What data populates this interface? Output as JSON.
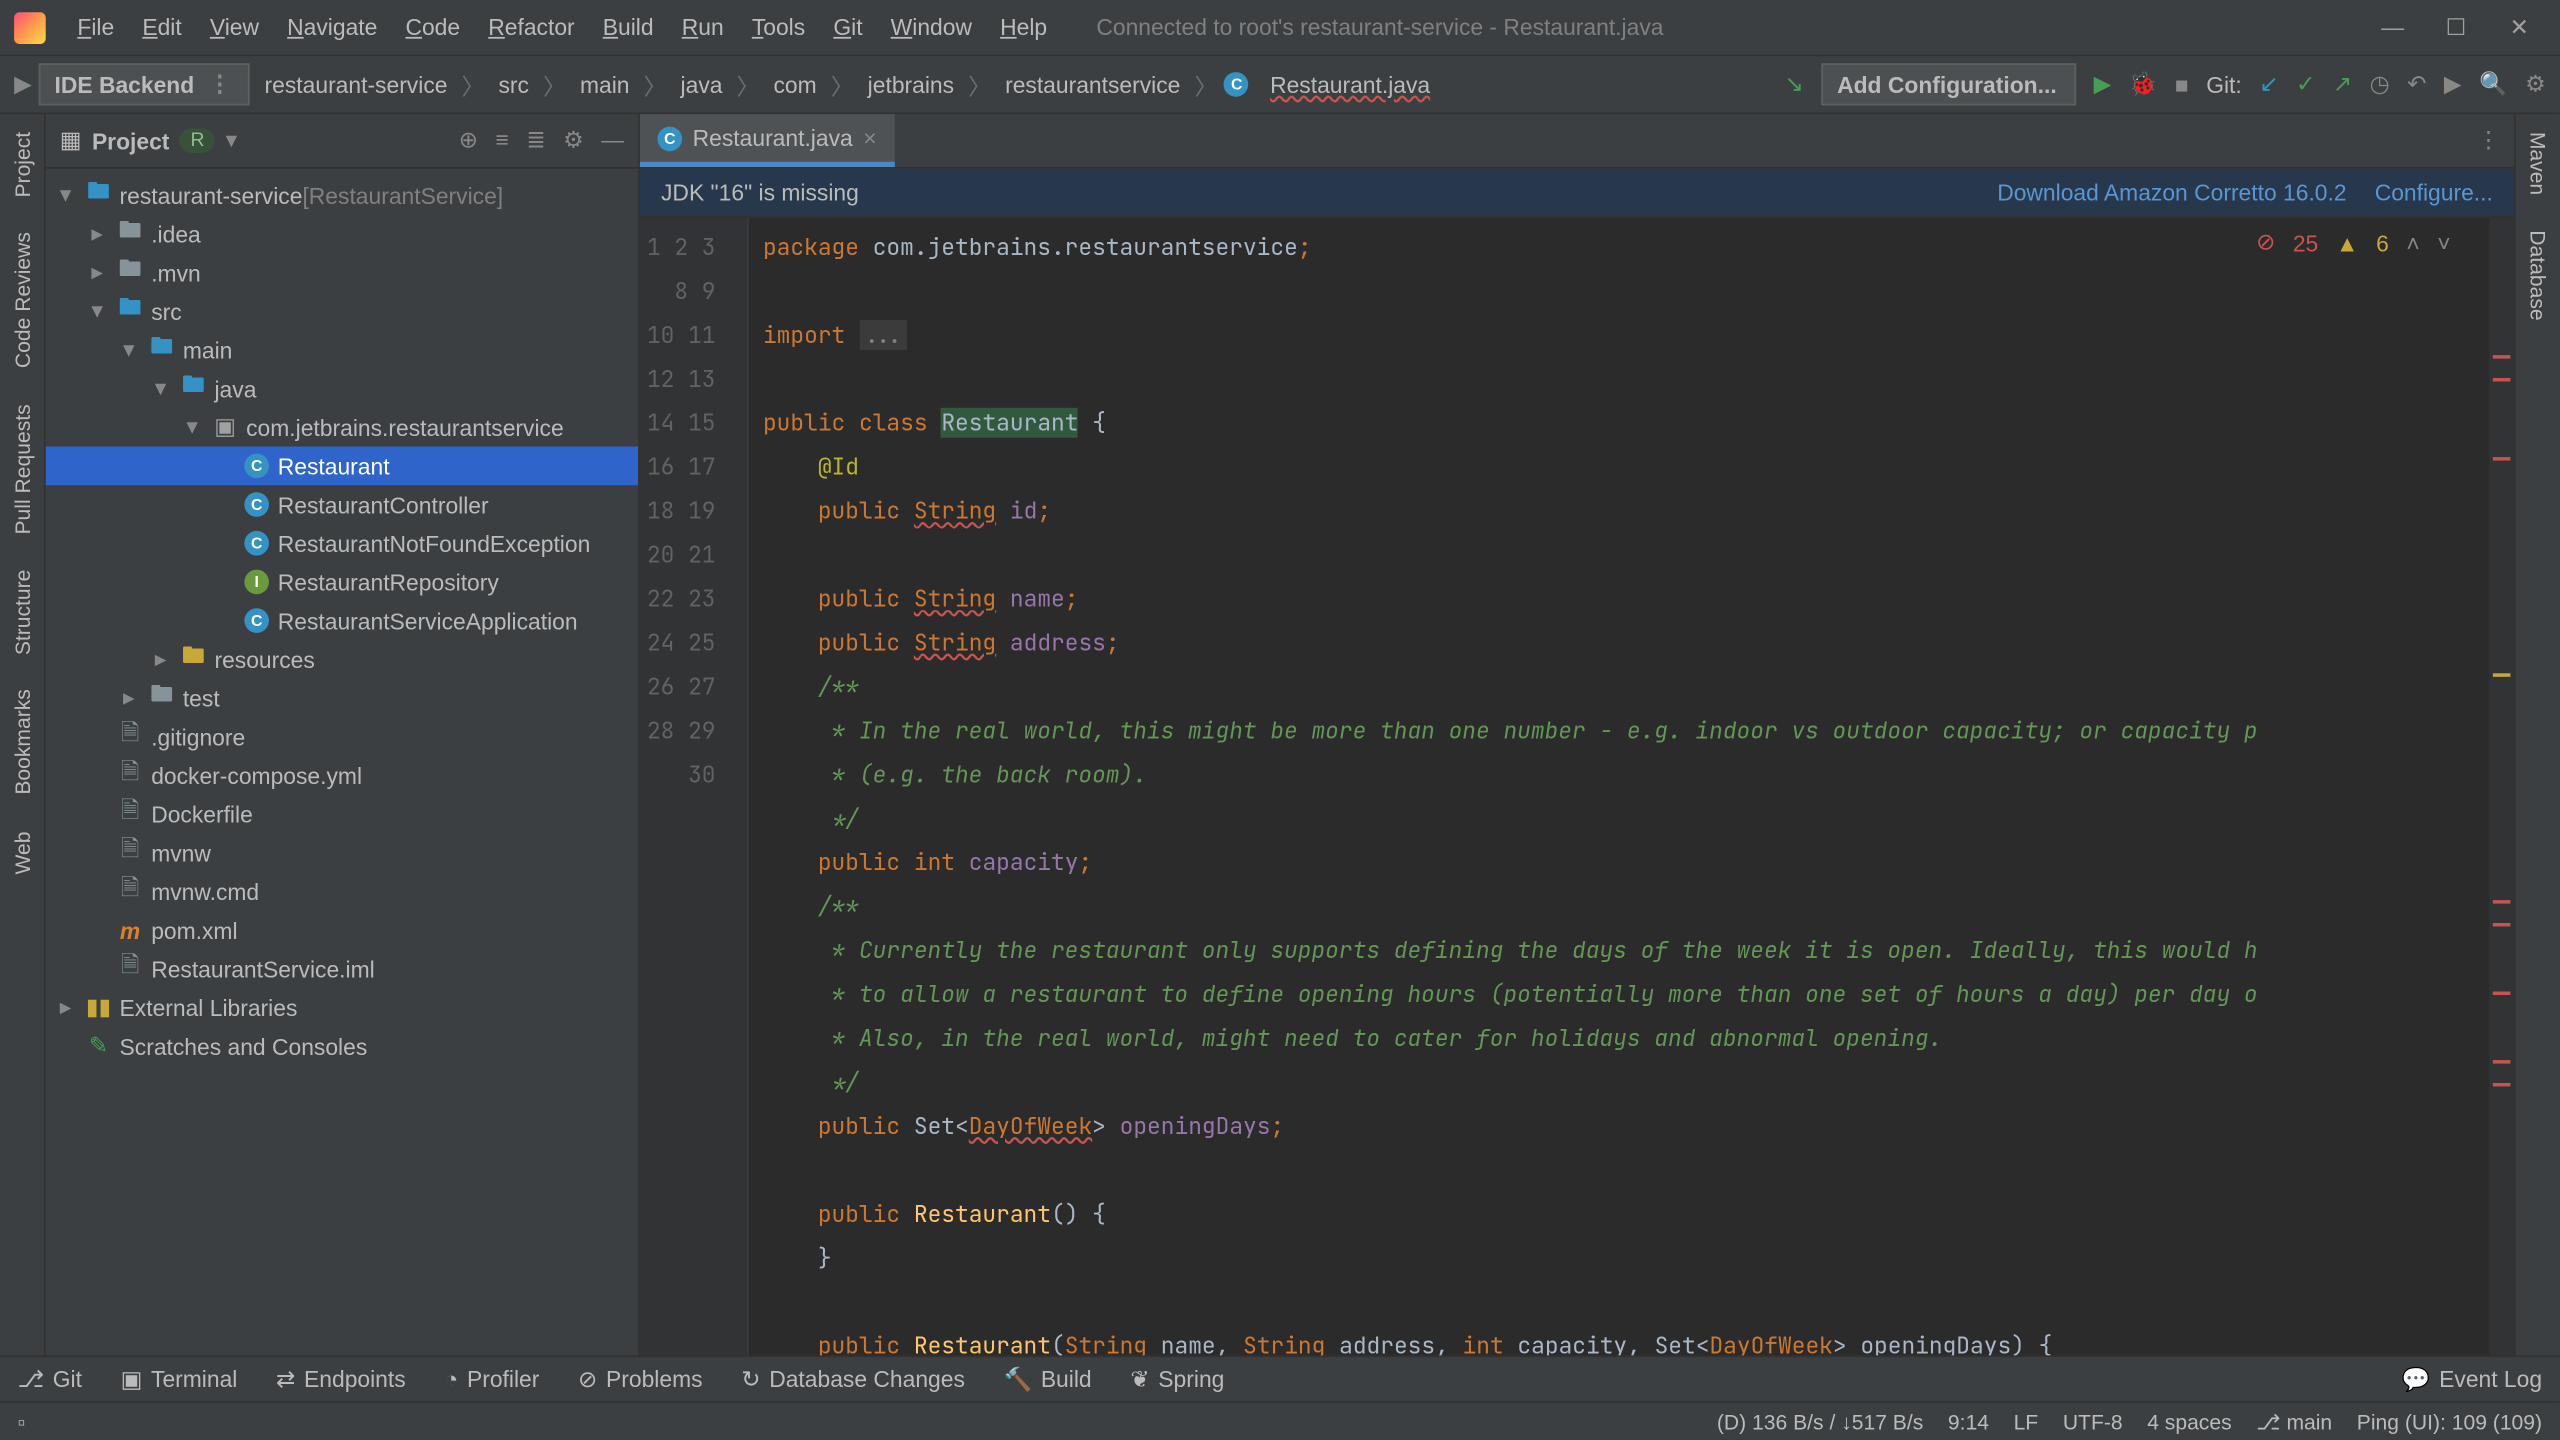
{
  "titlebar": {
    "menus": [
      "File",
      "Edit",
      "View",
      "Navigate",
      "Code",
      "Refactor",
      "Build",
      "Run",
      "Tools",
      "Git",
      "Window",
      "Help"
    ],
    "title": "Connected to root's restaurant-service - Restaurant.java"
  },
  "toolbar": {
    "run_config": "IDE Backend",
    "breadcrumbs": [
      "restaurant-service",
      "src",
      "main",
      "java",
      "com",
      "jetbrains",
      "restaurantservice",
      "Restaurant.java"
    ],
    "git_label": "Git:",
    "add_config": "Add Configuration..."
  },
  "left_gutter": {
    "tabs": [
      "Project",
      "Code Reviews",
      "Pull Requests",
      "Structure",
      "Bookmarks",
      "Web"
    ]
  },
  "right_gutter": {
    "tabs": [
      "Maven",
      "Database"
    ]
  },
  "project": {
    "header": "Project",
    "pill": "R",
    "tree": [
      {
        "depth": 0,
        "arrow": "▾",
        "icon": "folder-blue",
        "label": "restaurant-service",
        "suffix": " [RestaurantService]"
      },
      {
        "depth": 1,
        "arrow": "▸",
        "icon": "folder",
        "label": ".idea"
      },
      {
        "depth": 1,
        "arrow": "▸",
        "icon": "folder",
        "label": ".mvn"
      },
      {
        "depth": 1,
        "arrow": "▾",
        "icon": "folder-blue",
        "label": "src"
      },
      {
        "depth": 2,
        "arrow": "▾",
        "icon": "folder-blue",
        "label": "main"
      },
      {
        "depth": 3,
        "arrow": "▾",
        "icon": "folder-blue",
        "label": "java"
      },
      {
        "depth": 4,
        "arrow": "▾",
        "icon": "package",
        "label": "com.jetbrains.restaurantservice"
      },
      {
        "depth": 5,
        "arrow": "",
        "icon": "class",
        "label": "Restaurant",
        "selected": true
      },
      {
        "depth": 5,
        "arrow": "",
        "icon": "class",
        "label": "RestaurantController"
      },
      {
        "depth": 5,
        "arrow": "",
        "icon": "class",
        "label": "RestaurantNotFoundException"
      },
      {
        "depth": 5,
        "arrow": "",
        "icon": "interface",
        "label": "RestaurantRepository"
      },
      {
        "depth": 5,
        "arrow": "",
        "icon": "class",
        "label": "RestaurantServiceApplication"
      },
      {
        "depth": 3,
        "arrow": "▸",
        "icon": "resources",
        "label": "resources"
      },
      {
        "depth": 2,
        "arrow": "▸",
        "icon": "folder",
        "label": "test"
      },
      {
        "depth": 1,
        "arrow": "",
        "icon": "file",
        "label": ".gitignore"
      },
      {
        "depth": 1,
        "arrow": "",
        "icon": "file",
        "label": "docker-compose.yml"
      },
      {
        "depth": 1,
        "arrow": "",
        "icon": "file",
        "label": "Dockerfile"
      },
      {
        "depth": 1,
        "arrow": "",
        "icon": "file",
        "label": "mvnw"
      },
      {
        "depth": 1,
        "arrow": "",
        "icon": "file",
        "label": "mvnw.cmd"
      },
      {
        "depth": 1,
        "arrow": "",
        "icon": "m",
        "label": "pom.xml"
      },
      {
        "depth": 1,
        "arrow": "",
        "icon": "file",
        "label": "RestaurantService.iml"
      },
      {
        "depth": 0,
        "arrow": "▸",
        "icon": "lib",
        "label": "External Libraries"
      },
      {
        "depth": 0,
        "arrow": "",
        "icon": "scratch",
        "label": "Scratches and Consoles"
      }
    ]
  },
  "editor": {
    "tab_name": "Restaurant.java",
    "banner_msg": "JDK \"16\" is missing",
    "banner_link1": "Download Amazon Corretto 16.0.2",
    "banner_link2": "Configure...",
    "errors": "25",
    "warnings": "6",
    "code": {
      "l1_pkg": "package",
      "l1_rest": "com.jetbrains.restaurantservice",
      "l3_imp": "import",
      "l3_dots": "...",
      "l9_pub": "public",
      "l9_cls": "class",
      "l9_name": "Restaurant",
      "l9_brace": " {",
      "l10": "@Id",
      "l11_pub": "public",
      "l11_str": "String",
      "l11_id": "id",
      "l13_pub": "public",
      "l13_str": "String",
      "l13_name": "name",
      "l14_pub": "public",
      "l14_str": "String",
      "l14_addr": "address",
      "l15": "/**",
      "l16": " * In the real world, this might be more than one number - e.g. indoor vs outdoor capacity; or capacity p",
      "l17": " * (e.g. the back room).",
      "l18": " */",
      "l19_pub": "public",
      "l19_int": "int",
      "l19_cap": "capacity",
      "l20": "/**",
      "l21": " * Currently the restaurant only supports defining the days of the week it is open. Ideally, this would h",
      "l22": " * to allow a restaurant to define opening hours (potentially more than one set of hours a day) per day o",
      "l23": " * Also, in the real world, might need to cater for holidays and abnormal opening.",
      "l24": " */",
      "l25_pub": "public",
      "l25_set": "Set",
      "l25_dow": "DayOfWeek",
      "l25_open": "openingDays",
      "l27_pub": "public",
      "l27_ctor": "Restaurant",
      "l27_rest": "() {",
      "l28": "}",
      "l30_pub": "public",
      "l30_ctor": "Restaurant",
      "l30_p1t": "String",
      "l30_p1": "name",
      "l30_p2t": "String",
      "l30_p2": "address",
      "l30_p3t": "int",
      "l30_p3": "capacity",
      "l30_p4s": "Set",
      "l30_p4d": "DayOfWeek",
      "l30_p4": "openingDays) {"
    }
  },
  "bottom_tools": {
    "items": [
      "Git",
      "Terminal",
      "Endpoints",
      "Profiler",
      "Problems",
      "Database Changes",
      "Build",
      "Spring"
    ],
    "event_log": "Event Log"
  },
  "statusbar": {
    "net": "(D) 136 B/s / ↓517 B/s",
    "caret": "9:14",
    "le": "LF",
    "enc": "UTF-8",
    "indent": "4 spaces",
    "branch": "main",
    "ping": "Ping (UI): 109 (109)"
  }
}
